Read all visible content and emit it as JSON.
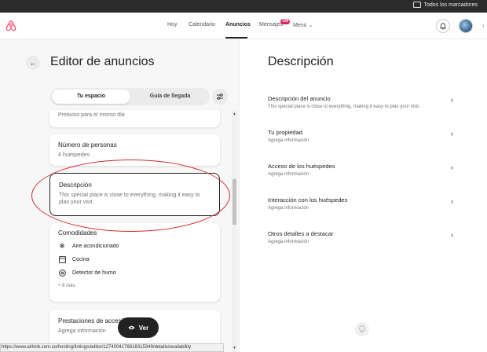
{
  "browser": {
    "bookmarks_label": "Todos los marcadores"
  },
  "header": {
    "nav": [
      "Hoy",
      "Calendario",
      "Anuncios",
      "Mensajes",
      "Menú"
    ],
    "active_nav": "Anuncios",
    "messages_badge": "199"
  },
  "editor": {
    "title": "Editor de anuncios",
    "tabs": [
      "Tu espacio",
      "Guía de llegada"
    ],
    "cards": {
      "preaviso": "Preaviso para el mismo día",
      "guests_title": "Número de personas",
      "guests_value": "4 huéspedes",
      "description_title": "Descripción",
      "description_text": "This special place is close to everything, making it easy to plan your visit.",
      "amenities_title": "Comodidades",
      "amenities": [
        {
          "label": "Aire acondicionado",
          "icon": "snowflake-icon"
        },
        {
          "label": "Cocina",
          "icon": "stove-icon"
        },
        {
          "label": "Detector de humo",
          "icon": "smoke-detector-icon"
        }
      ],
      "amenities_more": "+ 8 más",
      "accessibility_title": "Prestaciones de accesibilidad",
      "accessibility_value": "Agrega información"
    },
    "view_button": "Ver",
    "status_url": "https://www.airbnb.com.co/hosting/listings/editor/1274004176818315349/details/availability"
  },
  "description_panel": {
    "title": "Descripción",
    "rows": [
      {
        "label": "Descripción del anuncio",
        "sub": "This special place is close to everything, making it easy to plan your visit."
      },
      {
        "label": "Tu propiedad",
        "sub": "Agrega información"
      },
      {
        "label": "Acceso de los huéspedes",
        "sub": "Agrega información"
      },
      {
        "label": "Interacción con los huéspedes",
        "sub": "Agrega información"
      },
      {
        "label": "Otros detalles a destacar",
        "sub": "Agrega información"
      }
    ]
  },
  "colors": {
    "brand": "#FF385C",
    "badge": "#E31C5F",
    "annotation": "#D42828"
  }
}
